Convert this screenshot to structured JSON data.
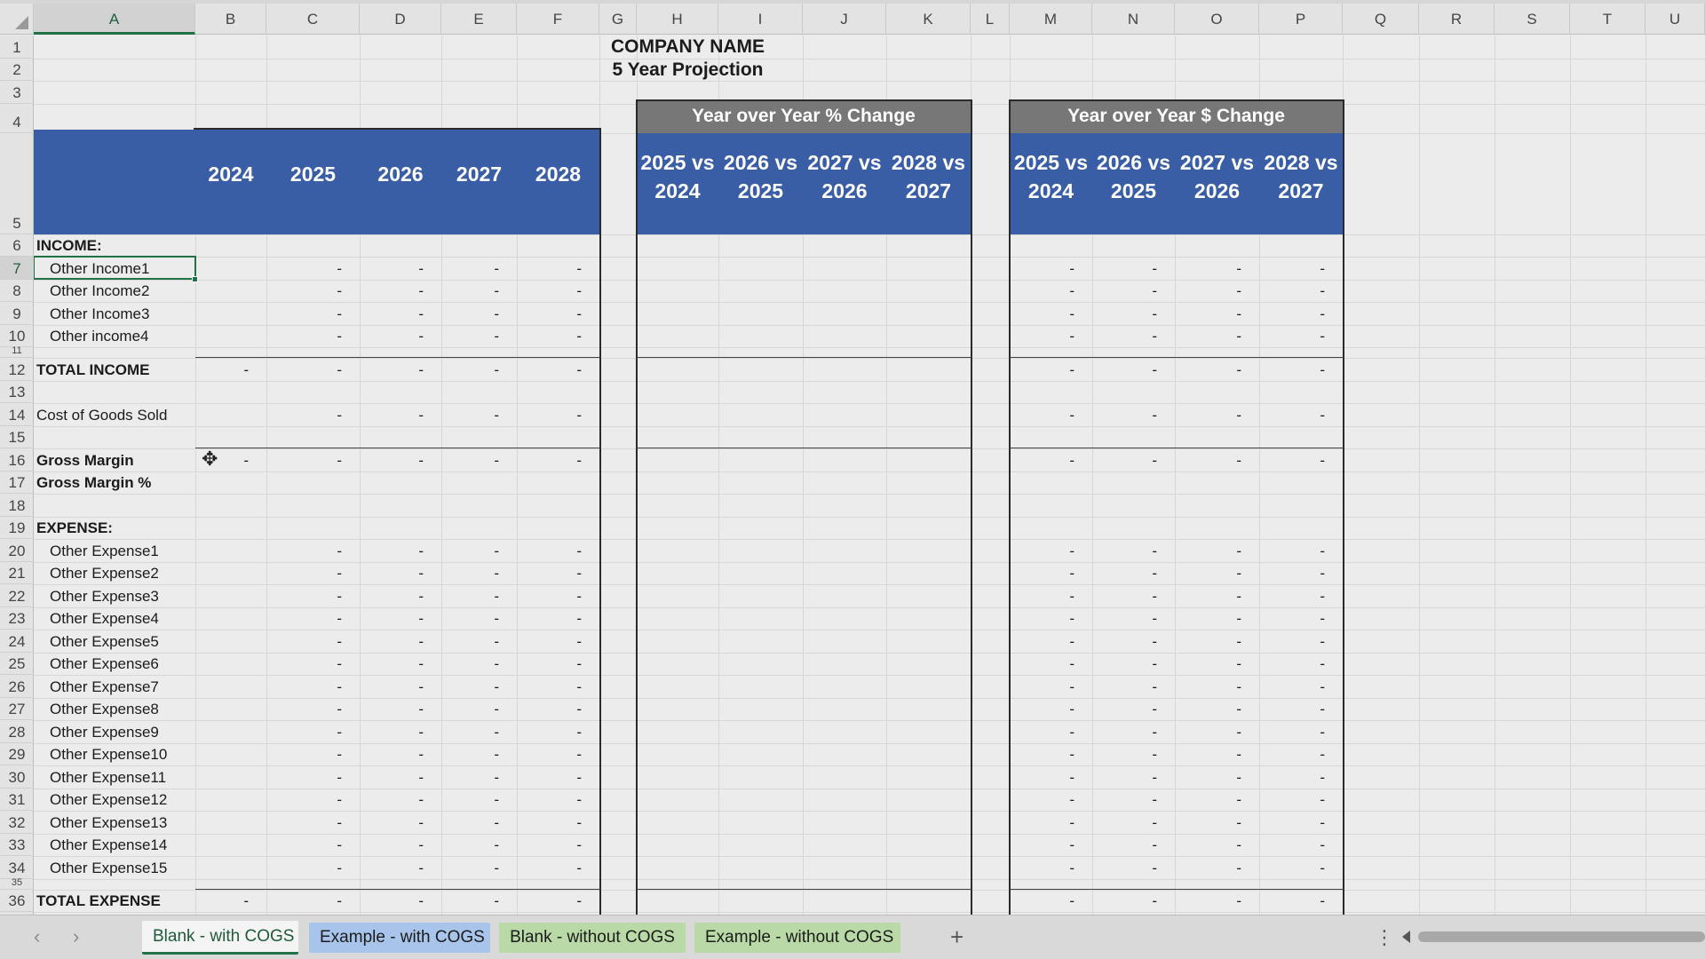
{
  "columns": [
    "A",
    "B",
    "C",
    "D",
    "E",
    "F",
    "G",
    "H",
    "I",
    "J",
    "K",
    "L",
    "M",
    "N",
    "O",
    "P",
    "Q",
    "R",
    "S",
    "T",
    "U"
  ],
  "rows": [
    "1",
    "2",
    "3",
    "4",
    "5",
    "6",
    "7",
    "8",
    "9",
    "10",
    "11",
    "12",
    "13",
    "14",
    "15",
    "16",
    "17",
    "18",
    "19",
    "20",
    "21",
    "22",
    "23",
    "24",
    "25",
    "26",
    "27",
    "28",
    "29",
    "30",
    "31",
    "32",
    "33",
    "34",
    "35",
    "36"
  ],
  "sheet": {
    "company_name": "COMPANY NAME",
    "subtitle": "5 Year Projection",
    "years": [
      "2024",
      "2025",
      "2026",
      "2027",
      "2028"
    ],
    "pct_change_title": "Year over Year % Change",
    "dollar_change_title": "Year over Year $ Change",
    "comparisons": [
      {
        "top": "2025 vs",
        "bottom": "2024"
      },
      {
        "top": "2026 vs",
        "bottom": "2025"
      },
      {
        "top": "2027 vs",
        "bottom": "2026"
      },
      {
        "top": "2028 vs",
        "bottom": "2027"
      }
    ],
    "dash": "-",
    "lines": [
      {
        "row": 6,
        "label": "INCOME:",
        "bold": true,
        "indent": false,
        "main": [],
        "dollar": false
      },
      {
        "row": 7,
        "label": "Other Income1",
        "bold": false,
        "indent": true,
        "main": [
          1,
          2,
          3,
          4
        ],
        "dollar": true
      },
      {
        "row": 8,
        "label": "Other Income2",
        "bold": false,
        "indent": true,
        "main": [
          1,
          2,
          3,
          4
        ],
        "dollar": true
      },
      {
        "row": 9,
        "label": "Other Income3",
        "bold": false,
        "indent": true,
        "main": [
          1,
          2,
          3,
          4
        ],
        "dollar": true
      },
      {
        "row": 10,
        "label": "Other income4",
        "bold": false,
        "indent": true,
        "main": [
          1,
          2,
          3,
          4
        ],
        "dollar": true
      },
      {
        "row": 12,
        "label": "TOTAL INCOME",
        "bold": true,
        "indent": false,
        "main": [
          0,
          1,
          2,
          3,
          4
        ],
        "dollar": true
      },
      {
        "row": 14,
        "label": "Cost of Goods Sold",
        "bold": false,
        "indent": false,
        "main": [
          1,
          2,
          3,
          4
        ],
        "dollar": true
      },
      {
        "row": 16,
        "label": "Gross Margin",
        "bold": true,
        "indent": false,
        "main": [
          0,
          1,
          2,
          3,
          4
        ],
        "dollar": true
      },
      {
        "row": 17,
        "label": "Gross Margin %",
        "bold": true,
        "indent": false,
        "main": [],
        "dollar": false
      },
      {
        "row": 19,
        "label": "EXPENSE:",
        "bold": true,
        "indent": false,
        "main": [],
        "dollar": false
      },
      {
        "row": 20,
        "label": "Other Expense1",
        "bold": false,
        "indent": true,
        "main": [
          1,
          2,
          3,
          4
        ],
        "dollar": true
      },
      {
        "row": 21,
        "label": "Other Expense2",
        "bold": false,
        "indent": true,
        "main": [
          1,
          2,
          3,
          4
        ],
        "dollar": true
      },
      {
        "row": 22,
        "label": "Other Expense3",
        "bold": false,
        "indent": true,
        "main": [
          1,
          2,
          3,
          4
        ],
        "dollar": true
      },
      {
        "row": 23,
        "label": "Other Expense4",
        "bold": false,
        "indent": true,
        "main": [
          1,
          2,
          3,
          4
        ],
        "dollar": true
      },
      {
        "row": 24,
        "label": "Other Expense5",
        "bold": false,
        "indent": true,
        "main": [
          1,
          2,
          3,
          4
        ],
        "dollar": true
      },
      {
        "row": 25,
        "label": "Other Expense6",
        "bold": false,
        "indent": true,
        "main": [
          1,
          2,
          3,
          4
        ],
        "dollar": true
      },
      {
        "row": 26,
        "label": "Other Expense7",
        "bold": false,
        "indent": true,
        "main": [
          1,
          2,
          3,
          4
        ],
        "dollar": true
      },
      {
        "row": 27,
        "label": "Other Expense8",
        "bold": false,
        "indent": true,
        "main": [
          1,
          2,
          3,
          4
        ],
        "dollar": true
      },
      {
        "row": 28,
        "label": "Other Expense9",
        "bold": false,
        "indent": true,
        "main": [
          1,
          2,
          3,
          4
        ],
        "dollar": true
      },
      {
        "row": 29,
        "label": "Other Expense10",
        "bold": false,
        "indent": true,
        "main": [
          1,
          2,
          3,
          4
        ],
        "dollar": true
      },
      {
        "row": 30,
        "label": "Other Expense11",
        "bold": false,
        "indent": true,
        "main": [
          1,
          2,
          3,
          4
        ],
        "dollar": true
      },
      {
        "row": 31,
        "label": "Other Expense12",
        "bold": false,
        "indent": true,
        "main": [
          1,
          2,
          3,
          4
        ],
        "dollar": true
      },
      {
        "row": 32,
        "label": "Other Expense13",
        "bold": false,
        "indent": true,
        "main": [
          1,
          2,
          3,
          4
        ],
        "dollar": true
      },
      {
        "row": 33,
        "label": "Other Expense14",
        "bold": false,
        "indent": true,
        "main": [
          1,
          2,
          3,
          4
        ],
        "dollar": true
      },
      {
        "row": 34,
        "label": "Other Expense15",
        "bold": false,
        "indent": true,
        "main": [
          1,
          2,
          3,
          4
        ],
        "dollar": true
      },
      {
        "row": 36,
        "label": "TOTAL EXPENSE",
        "bold": true,
        "indent": false,
        "main": [
          0,
          1,
          2,
          3,
          4
        ],
        "dollar": true
      }
    ]
  },
  "selected_cell": "A7",
  "tabs": [
    {
      "label": "Blank - with COGS",
      "active": true,
      "color": "#f4f4f4"
    },
    {
      "label": "Example - with COGS",
      "active": false,
      "color": "#a9c4ea"
    },
    {
      "label": "Blank - without COGS",
      "active": false,
      "color": "#b9daa7"
    },
    {
      "label": "Example - without COGS",
      "active": false,
      "color": "#b9daa7"
    }
  ],
  "icons": {
    "prev_sheet": "chevron-left-icon",
    "next_sheet": "chevron-right-icon",
    "add_sheet": "plus-icon",
    "more": "vertical-ellipsis-icon",
    "cursor": "move-cross-cursor-icon"
  },
  "colors": {
    "header_blue": "#3a5ea6",
    "header_gray": "#777777",
    "excel_green": "#217346"
  }
}
